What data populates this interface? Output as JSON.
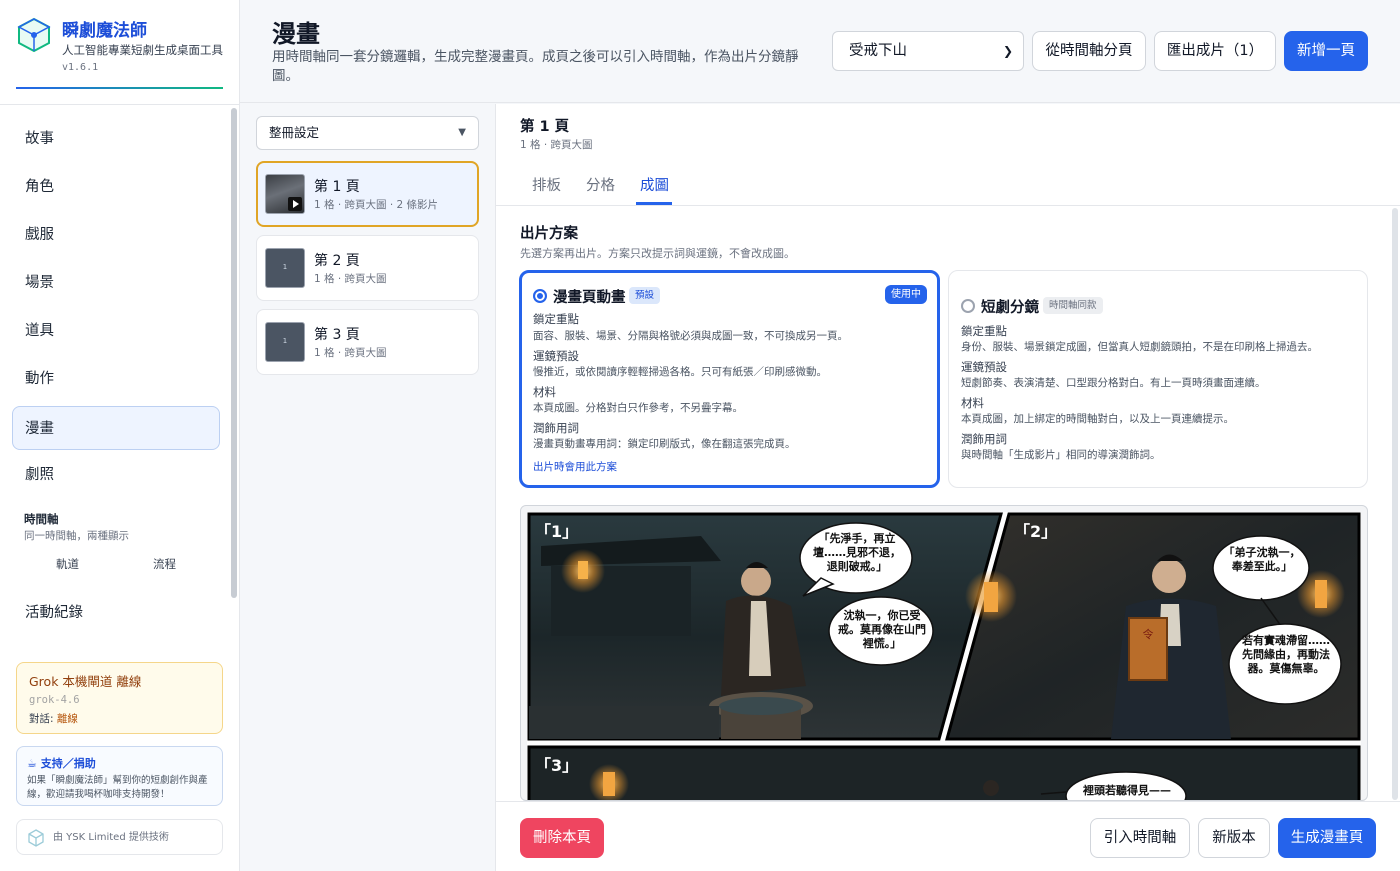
{
  "app": {
    "name": "瞬劇魔法師",
    "subtitle": "人工智能專業短劇生成桌面工具",
    "version": "v1.6.1"
  },
  "sidebar": {
    "items": [
      {
        "label": "故事"
      },
      {
        "label": "角色"
      },
      {
        "label": "戲服"
      },
      {
        "label": "場景"
      },
      {
        "label": "道具"
      },
      {
        "label": "動作"
      },
      {
        "label": "漫畫",
        "active": true
      },
      {
        "label": "劇照"
      }
    ],
    "timeline": {
      "title": "時間軸",
      "subtitle": "同一時間軸，兩種顯示",
      "options": [
        "軌道",
        "流程"
      ]
    },
    "activity_label": "活動紀錄",
    "grok": {
      "title": "Grok 本機閘道 離線",
      "model": "grok-4.6",
      "status_label": "對話:",
      "status_value": "離線"
    },
    "donate": {
      "title": "☕ 支持／捐助",
      "text": "如果「瞬劇魔法師」幫到你的短劇創作與產線，歡迎請我喝杯咖啡支持開發！"
    },
    "provider": "由 YSK Limited 提供技術"
  },
  "header": {
    "title": "漫畫",
    "description": "用時間軸同一套分鏡邏輯，生成完整漫畫頁。成頁之後可以引入時間軸，作為出片分鏡靜圖。",
    "project_select": "受戒下山",
    "buttons": {
      "split": "從時間軸分頁",
      "export": "匯出成片（1）",
      "add_page": "新增一頁"
    }
  },
  "pages": {
    "volume_select": "整冊設定",
    "list": [
      {
        "name": "第 1 頁",
        "meta": "1 格 · 跨頁大圖 · 2 條影片",
        "active": true,
        "thumb_num": ""
      },
      {
        "name": "第 2 頁",
        "meta": "1 格 · 跨頁大圖",
        "active": false,
        "thumb_num": "1"
      },
      {
        "name": "第 3 頁",
        "meta": "1 格 · 跨頁大圖",
        "active": false,
        "thumb_num": "1"
      }
    ]
  },
  "editor": {
    "title": "第 1 頁",
    "meta": "1 格 · 跨頁大圖",
    "tabs": [
      "排板",
      "分格",
      "成圖"
    ],
    "active_tab": "成圖",
    "plan_title": "出片方案",
    "plan_subtitle": "先選方案再出片。方案只改提示詞與運鏡，不會改成圖。",
    "plans": [
      {
        "name": "漫畫頁動畫",
        "tag": "預設",
        "badge": "使用中",
        "selected": true,
        "rows": [
          {
            "k": "鎖定重點",
            "v": "面容、服裝、場景、分隔與格號必須與成圖一致，不可換成另一頁。"
          },
          {
            "k": "運鏡預設",
            "v": "慢推近，或依閱讀序輕輕掃過各格。只可有紙張／印刷感微動。"
          },
          {
            "k": "材料",
            "v": "本頁成圖。分格對白只作參考，不另疊字幕。"
          },
          {
            "k": "潤飾用詞",
            "v": "漫畫頁動畫專用詞：鎖定印刷版式，像在翻這張完成頁。"
          }
        ],
        "note": "出片時會用此方案"
      },
      {
        "name": "短劇分鏡",
        "tag": "時間軸同款",
        "selected": false,
        "rows": [
          {
            "k": "鎖定重點",
            "v": "身份、服裝、場景鎖定成圖，但當真人短劇鏡頭拍，不是在印刷格上掃過去。"
          },
          {
            "k": "運鏡預設",
            "v": "短劇節奏、表演清楚、口型跟分格對白。有上一頁時須畫面連續。"
          },
          {
            "k": "材料",
            "v": "本頁成圖，加上綁定的時間軸對白，以及上一頁連續提示。"
          },
          {
            "k": "潤飾用詞",
            "v": "與時間軸「生成影片」相同的導演潤飾詞。"
          }
        ]
      }
    ],
    "comic": {
      "panels": [
        "「1」",
        "「2」",
        "「3」"
      ],
      "bubbles": [
        "「先淨手，再立壇……見邪不退，退則破戒。」",
        "沈執一，你已受戒。莫再像在山門裡慌。」",
        "「弟子沈執一，奉差至此。」",
        "若有實魂滯留……先問緣由，再動法器。莫傷無辜。",
        "裡頭若聽得見——"
      ],
      "book_label": "令",
      "colors": {
        "ink": "#111111",
        "night": "#1e2a2e",
        "lantern": "#f2a541"
      }
    }
  },
  "footer": {
    "delete": "刪除本頁",
    "import_timeline": "引入時間軸",
    "new_version": "新版本",
    "generate": "生成漫畫頁"
  },
  "colors": {
    "primary": "#2563eb",
    "danger": "#ef4560",
    "active_page_border": "#e0a526"
  }
}
